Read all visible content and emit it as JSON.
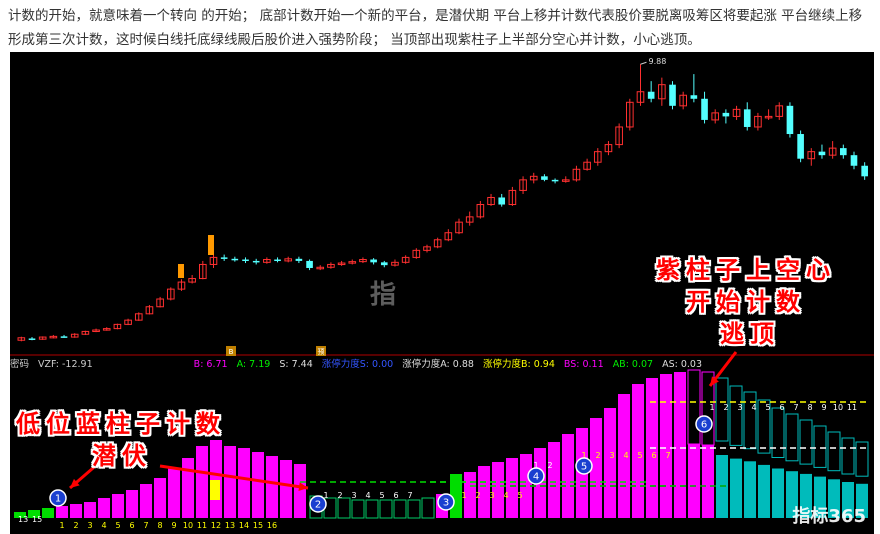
{
  "description": "计数的开始，就意味着一个转向 的开始；   底部计数开始一个新的平台，是潜伏期 平台上移并计数代表股价要脱离吸筹区将要起涨 平台继续上移形成第三次计数，这时候白线托底绿线殿后股价进入强势阶段；  当顶部出现紫柱子上半部分空心并计数，小心逃顶。",
  "price_high_label": "9.88",
  "indicator": {
    "name": "密码",
    "vzf": "VZF: -12.91",
    "b": "B: 6.71",
    "a": "A: 7.19",
    "s": "S: 7.44",
    "zt_s": "涨停力度S: 0.00",
    "zt_a": "涨停力度A: 0.88",
    "zt_b": "涨停力度B: 0.94",
    "bs": "BS: 0.11",
    "ab": "AB: 0.07",
    "as": "AS: 0.03"
  },
  "annotations": {
    "left_line1": "低位蓝柱子计数",
    "left_line2": "潜伏",
    "right_line1": "紫柱子上空心",
    "right_line2": "开始计数",
    "right_line3": "逃顶"
  },
  "markers": {
    "buy": "B",
    "warn": "预"
  },
  "watermark_center": "指",
  "watermark": "指标365",
  "colors": {
    "up": "#ff3030",
    "down": "#54ffff",
    "magenta": "#ff00ff",
    "green": "#00dd00",
    "yellow": "#ffff00",
    "teal": "#00bbbb",
    "white": "#ffffff",
    "blue": "#1a3fd0"
  },
  "chart_data": {
    "type": "candlestick",
    "candles": [
      [
        2.05,
        2.12,
        2.15,
        2.02
      ],
      [
        2.1,
        2.08,
        2.14,
        2.05
      ],
      [
        2.08,
        2.14,
        2.16,
        2.06
      ],
      [
        2.12,
        2.16,
        2.2,
        2.1
      ],
      [
        2.16,
        2.14,
        2.2,
        2.12
      ],
      [
        2.14,
        2.22,
        2.25,
        2.12
      ],
      [
        2.22,
        2.3,
        2.32,
        2.2
      ],
      [
        2.3,
        2.34,
        2.38,
        2.28
      ],
      [
        2.34,
        2.38,
        2.42,
        2.32
      ],
      [
        2.38,
        2.5,
        2.52,
        2.36
      ],
      [
        2.5,
        2.62,
        2.66,
        2.48
      ],
      [
        2.62,
        2.8,
        2.84,
        2.6
      ],
      [
        2.8,
        3.0,
        3.05,
        2.78
      ],
      [
        3.0,
        3.22,
        3.28,
        2.98
      ],
      [
        3.22,
        3.5,
        3.55,
        3.18
      ],
      [
        3.5,
        3.7,
        3.78,
        3.45
      ],
      [
        3.7,
        3.8,
        3.9,
        3.66
      ],
      [
        3.8,
        4.2,
        4.3,
        3.78
      ],
      [
        4.2,
        4.4,
        4.7,
        4.1
      ],
      [
        4.4,
        4.36,
        4.48,
        4.3
      ],
      [
        4.36,
        4.34,
        4.42,
        4.28
      ],
      [
        4.34,
        4.3,
        4.4,
        4.24
      ],
      [
        4.3,
        4.26,
        4.36,
        4.2
      ],
      [
        4.26,
        4.34,
        4.4,
        4.22
      ],
      [
        4.34,
        4.3,
        4.4,
        4.26
      ],
      [
        4.3,
        4.36,
        4.42,
        4.26
      ],
      [
        4.36,
        4.3,
        4.42,
        4.24
      ],
      [
        4.3,
        4.1,
        4.34,
        4.04
      ],
      [
        4.1,
        4.12,
        4.18,
        4.04
      ],
      [
        4.12,
        4.2,
        4.26,
        4.08
      ],
      [
        4.2,
        4.24,
        4.3,
        4.16
      ],
      [
        4.24,
        4.28,
        4.34,
        4.2
      ],
      [
        4.28,
        4.34,
        4.4,
        4.24
      ],
      [
        4.34,
        4.26,
        4.38,
        4.2
      ],
      [
        4.26,
        4.18,
        4.3,
        4.12
      ],
      [
        4.18,
        4.26,
        4.34,
        4.14
      ],
      [
        4.26,
        4.4,
        4.46,
        4.22
      ],
      [
        4.4,
        4.6,
        4.66,
        4.36
      ],
      [
        4.6,
        4.7,
        4.76,
        4.54
      ],
      [
        4.7,
        4.9,
        4.96,
        4.66
      ],
      [
        4.9,
        5.1,
        5.2,
        4.86
      ],
      [
        5.1,
        5.4,
        5.5,
        5.06
      ],
      [
        5.4,
        5.55,
        5.7,
        5.3
      ],
      [
        5.55,
        5.9,
        6.0,
        5.5
      ],
      [
        5.9,
        6.1,
        6.2,
        5.86
      ],
      [
        6.1,
        5.9,
        6.2,
        5.84
      ],
      [
        5.9,
        6.3,
        6.4,
        5.86
      ],
      [
        6.3,
        6.6,
        6.7,
        6.2
      ],
      [
        6.6,
        6.7,
        6.8,
        6.5
      ],
      [
        6.7,
        6.6,
        6.76,
        6.56
      ],
      [
        6.6,
        6.56,
        6.64,
        6.5
      ],
      [
        6.56,
        6.6,
        6.7,
        6.52
      ],
      [
        6.6,
        6.9,
        7.0,
        6.55
      ],
      [
        6.9,
        7.1,
        7.2,
        6.86
      ],
      [
        7.1,
        7.4,
        7.5,
        7.0
      ],
      [
        7.4,
        7.6,
        7.7,
        7.3
      ],
      [
        7.6,
        8.1,
        8.2,
        7.5
      ],
      [
        8.1,
        8.8,
        8.9,
        8.0
      ],
      [
        8.8,
        9.1,
        9.88,
        8.7
      ],
      [
        9.1,
        8.9,
        9.4,
        8.8
      ],
      [
        8.9,
        9.3,
        9.5,
        8.7
      ],
      [
        9.3,
        8.7,
        9.4,
        8.6
      ],
      [
        8.7,
        9.0,
        9.1,
        8.6
      ],
      [
        9.0,
        8.9,
        9.6,
        8.8
      ],
      [
        8.9,
        8.3,
        9.1,
        8.2
      ],
      [
        8.3,
        8.5,
        8.6,
        8.2
      ],
      [
        8.5,
        8.4,
        8.6,
        8.2
      ],
      [
        8.4,
        8.6,
        8.7,
        8.3
      ],
      [
        8.6,
        8.1,
        8.8,
        8.0
      ],
      [
        8.1,
        8.4,
        8.5,
        8.0
      ],
      [
        8.4,
        8.4,
        8.6,
        8.3
      ],
      [
        8.4,
        8.7,
        8.8,
        8.3
      ],
      [
        8.7,
        7.9,
        8.8,
        7.8
      ],
      [
        7.9,
        7.2,
        8.0,
        7.1
      ],
      [
        7.2,
        7.4,
        7.5,
        7.0
      ],
      [
        7.4,
        7.3,
        7.6,
        7.2
      ],
      [
        7.3,
        7.5,
        7.7,
        7.2
      ],
      [
        7.5,
        7.3,
        7.6,
        7.2
      ],
      [
        7.3,
        7.0,
        7.4,
        6.9
      ],
      [
        7.0,
        6.7,
        7.1,
        6.6
      ]
    ],
    "ohlc_order": [
      "open",
      "close",
      "high",
      "low"
    ],
    "ylim": [
      2.0,
      10.0
    ]
  },
  "counts": {
    "seq1": [
      "1",
      "2",
      "3",
      "4",
      "5",
      "6",
      "7",
      "8",
      "9",
      "10",
      "11",
      "12",
      "13",
      "14",
      "15",
      "16"
    ],
    "seq2": [
      "1",
      "2",
      "3",
      "4",
      "5",
      "6",
      "7"
    ],
    "seq3": [
      "1",
      "2",
      "3",
      "4",
      "5"
    ],
    "seq4": [
      "1",
      "2"
    ],
    "seq5": [
      "1",
      "2",
      "3",
      "4",
      "5",
      "6",
      "7"
    ],
    "seq6": [
      "1",
      "2",
      "3",
      "4",
      "5",
      "6",
      "7",
      "8",
      "9",
      "10",
      "11"
    ],
    "circles": [
      "1",
      "2",
      "3",
      "4",
      "5",
      "6"
    ],
    "first_green_labels": [
      "13",
      "15"
    ]
  }
}
